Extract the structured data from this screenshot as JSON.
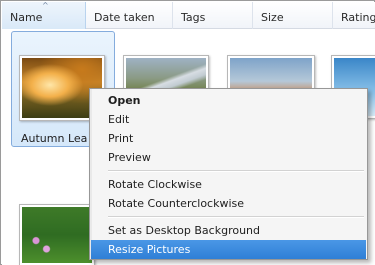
{
  "columns": {
    "name": "Name",
    "date_taken": "Date taken",
    "tags": "Tags",
    "size": "Size",
    "rating": "Rating"
  },
  "sort_indicator": "^",
  "thumbnails": [
    {
      "caption": "Autumn Leaves",
      "selected": true
    },
    {
      "caption": "",
      "selected": false
    },
    {
      "caption": "",
      "selected": false
    },
    {
      "caption": "",
      "selected": false
    },
    {
      "caption": "",
      "selected": false
    }
  ],
  "context_menu": {
    "items": [
      {
        "label": "Open",
        "bold": true
      },
      {
        "label": "Edit"
      },
      {
        "label": "Print"
      },
      {
        "label": "Preview"
      },
      {
        "label": "Rotate Clockwise"
      },
      {
        "label": "Rotate Counterclockwise"
      },
      {
        "label": "Set as Desktop Background"
      },
      {
        "label": "Resize Pictures",
        "highlighted": true
      }
    ],
    "highlight_color": "#3a8ae0"
  }
}
